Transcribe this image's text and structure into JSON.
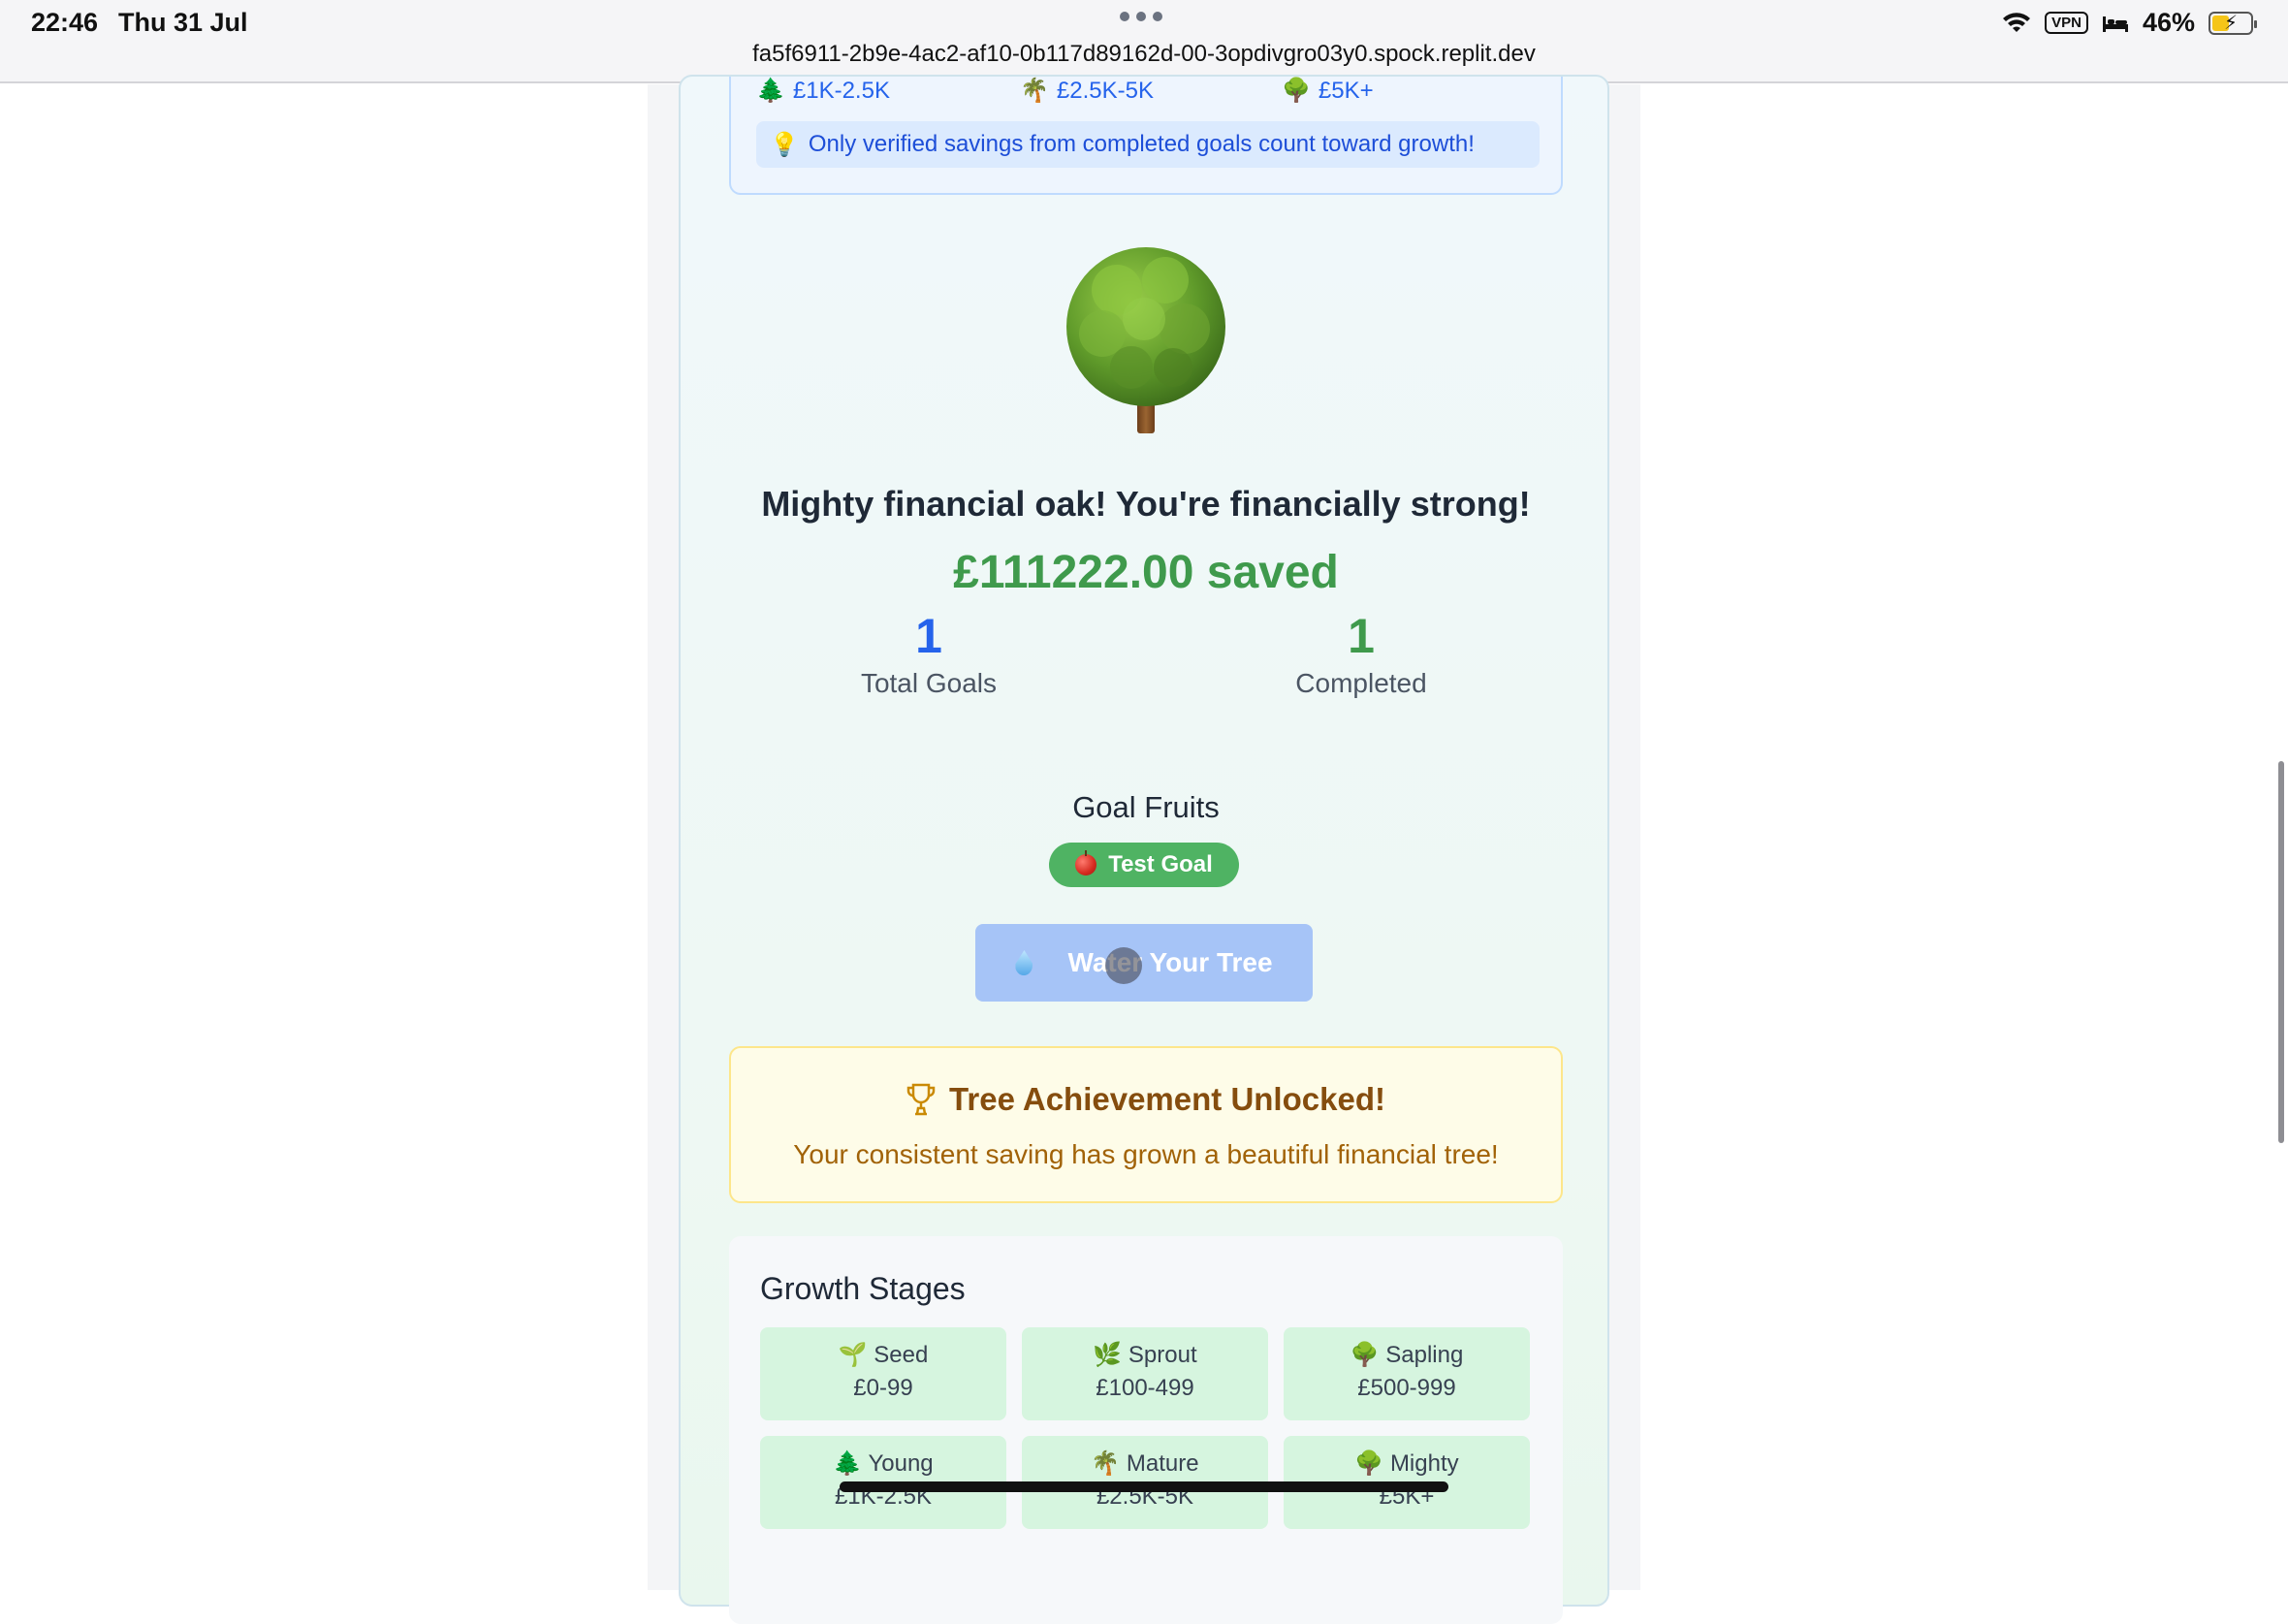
{
  "status_bar": {
    "time": "22:46",
    "date": "Thu 31 Jul",
    "url": "fa5f6911-2b9e-4ac2-af10-0b117d89162d-00-3opdivgro03y0.spock.replit.dev",
    "vpn": "VPN",
    "battery": "46%",
    "battery_level": 0.46
  },
  "info_box": {
    "legend": [
      {
        "icon": "🌲",
        "label": "£1K-2.5K"
      },
      {
        "icon": "🌴",
        "label": "£2.5K-5K"
      },
      {
        "icon": "🌳",
        "label": "£5K+"
      }
    ],
    "tip_icon": "💡",
    "tip": "Only verified savings from completed goals count toward growth!"
  },
  "tree": {
    "icon": "mighty-oak-tree-icon",
    "headline": "Mighty financial oak! You're financially strong!",
    "saved": "£111222.00 saved"
  },
  "stats": {
    "total_goals_value": "1",
    "total_goals_label": "Total Goals",
    "completed_value": "1",
    "completed_label": "Completed"
  },
  "fruits": {
    "title": "Goal Fruits",
    "items": [
      {
        "label": "Test Goal"
      }
    ]
  },
  "water_button": {
    "label": "Water Your Tree"
  },
  "achievement": {
    "title": "Tree Achievement Unlocked!",
    "text": "Your consistent saving has grown a beautiful financial tree!"
  },
  "growth": {
    "title": "Growth Stages",
    "stages": [
      {
        "icon": "🌱",
        "name": "Seed",
        "range": "£0-99"
      },
      {
        "icon": "🌿",
        "name": "Sprout",
        "range": "£100-499"
      },
      {
        "icon": "🌳",
        "name": "Sapling",
        "range": "£500-999"
      },
      {
        "icon": "🌲",
        "name": "Young",
        "range": "£1K-2.5K"
      },
      {
        "icon": "🌴",
        "name": "Mature",
        "range": "£2.5K-5K"
      },
      {
        "icon": "🌳",
        "name": "Mighty",
        "range": "£5K+"
      }
    ]
  },
  "colors": {
    "accent_green": "#3f9a4c",
    "accent_blue": "#2563eb",
    "button_blue": "#a6c4f7",
    "achievement_text": "#854d0e"
  }
}
